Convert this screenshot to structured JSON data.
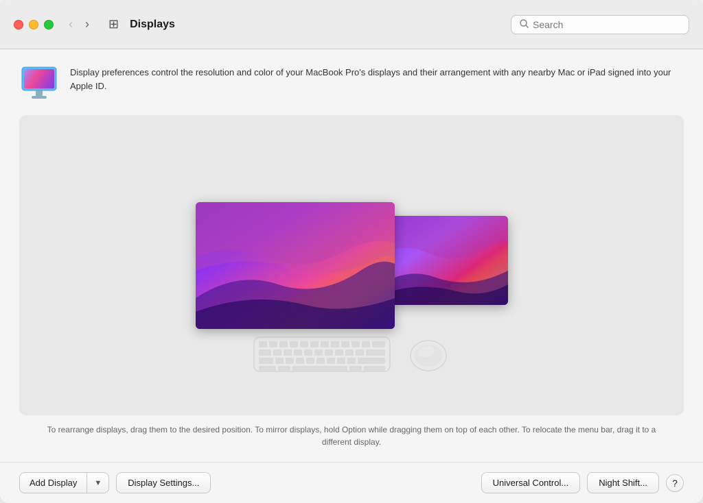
{
  "window": {
    "title": "Displays"
  },
  "titlebar": {
    "back_disabled": true,
    "forward_disabled": true
  },
  "search": {
    "placeholder": "Search"
  },
  "description": {
    "text": "Display preferences control the resolution and color of your MacBook Pro's displays and their arrangement with any nearby Mac or iPad signed into your Apple ID."
  },
  "instructions": {
    "text": "To rearrange displays, drag them to the desired position. To mirror displays, hold Option while dragging them on top of each other. To relocate the menu bar, drag it to a different display."
  },
  "buttons": {
    "add_display": "Add Display",
    "display_settings": "Display Settings...",
    "universal_control": "Universal Control...",
    "night_shift": "Night Shift...",
    "help": "?"
  },
  "colors": {
    "traffic_close": "#ff5f56",
    "traffic_minimize": "#ffbd2e",
    "traffic_maximize": "#27c93f"
  }
}
